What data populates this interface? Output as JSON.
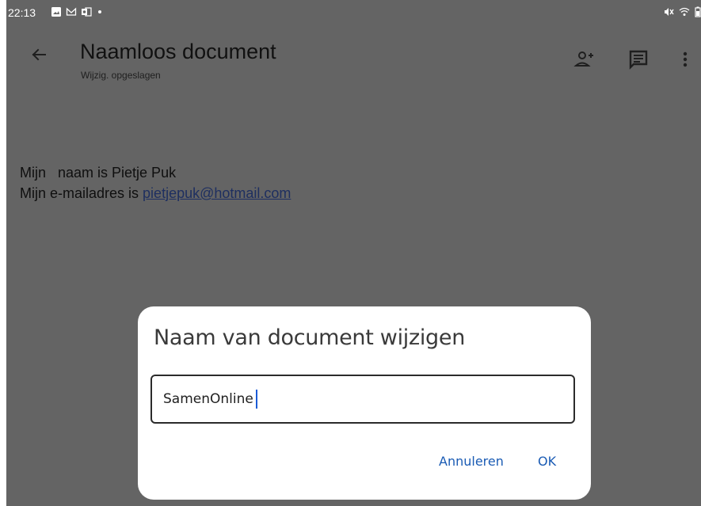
{
  "status_bar": {
    "time": "22:13",
    "left_icons": [
      "image-icon",
      "gmail-icon",
      "outlook-icon",
      "dot-icon"
    ],
    "right_icons": [
      "mute-icon",
      "wifi-icon",
      "battery-icon"
    ]
  },
  "app_bar": {
    "title": "Naamloos document",
    "subtitle": "Wijzig. opgeslagen",
    "actions": [
      "add-person-icon",
      "comment-icon",
      "more-vert-icon"
    ]
  },
  "document": {
    "line1": "Mijn   naam is Pietje Puk",
    "line2_prefix": "Mijn e-mailadres is ",
    "email_link": "pietjepuk@hotmail.com"
  },
  "dialog": {
    "title": "Naam van document wijzigen",
    "input_value": "SamenOnline",
    "cancel_label": "Annuleren",
    "ok_label": "OK"
  },
  "colors": {
    "scrim": "#646464",
    "accent": "#1a5bb4",
    "caret": "#1a5bd6",
    "dialog_bg": "#ffffff"
  }
}
